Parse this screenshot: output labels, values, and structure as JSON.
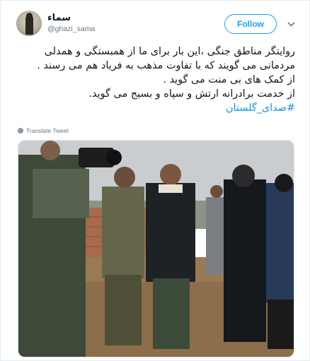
{
  "user": {
    "display_name": "سماء",
    "handle": "@ghazi_sama"
  },
  "follow_label": "Follow",
  "tweet": {
    "lines": [
      "روایتگر مناطق جنگی ،این بار برای ما از همبستگی و همدلی",
      "مردمانی می گویند که با تفاوت مذهب به فریاد هم می رسند .",
      "از کمک های بی منت می گوید .",
      "از خدمت برادرانه  ارتش و سپاه و بسیج می گوید."
    ],
    "hashtag": "#صدای_گلستان"
  },
  "translate_label": "Translate Tweet",
  "colors": {
    "accent": "#1da1f2",
    "hashtag": "#1b95e0",
    "muted": "#657786"
  },
  "icons": {
    "menu": "chevron-down-icon",
    "translate": "globe-icon"
  }
}
